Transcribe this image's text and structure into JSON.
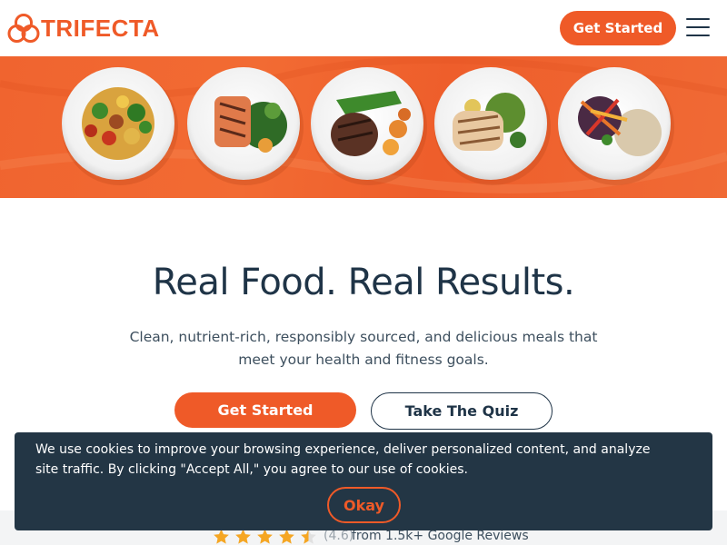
{
  "brand": {
    "name": "TRIFECTA",
    "accent_color": "#ef5a28",
    "text_color": "#1f3447"
  },
  "header": {
    "cta_label": "Get Started",
    "menu_icon": "hamburger-icon"
  },
  "hero": {
    "image_description_icon": "meal-plates-banner",
    "plates": [
      "stir-fry-plate",
      "salmon-plate",
      "steak-plate",
      "chicken-plate",
      "veggie-rice-plate"
    ]
  },
  "main": {
    "headline": "Real Food. Real Results.",
    "subtext": "Clean, nutrient-rich, responsibly sourced, and delicious meals that meet your health and fitness goals.",
    "primary_cta": "Get Started",
    "secondary_cta": "Take The Quiz"
  },
  "reviews": {
    "stars": 4.5,
    "rating_text": "(4.6)",
    "source_text": "from 1.5k+ Google Reviews",
    "star_color": "#f5a623"
  },
  "cookie_banner": {
    "message": "We use cookies to improve your browsing experience, deliver personalized content, and analyze site traffic. By clicking \"Accept All,\" you agree to our use of cookies.",
    "button_label": "Okay",
    "background": "#233645"
  }
}
